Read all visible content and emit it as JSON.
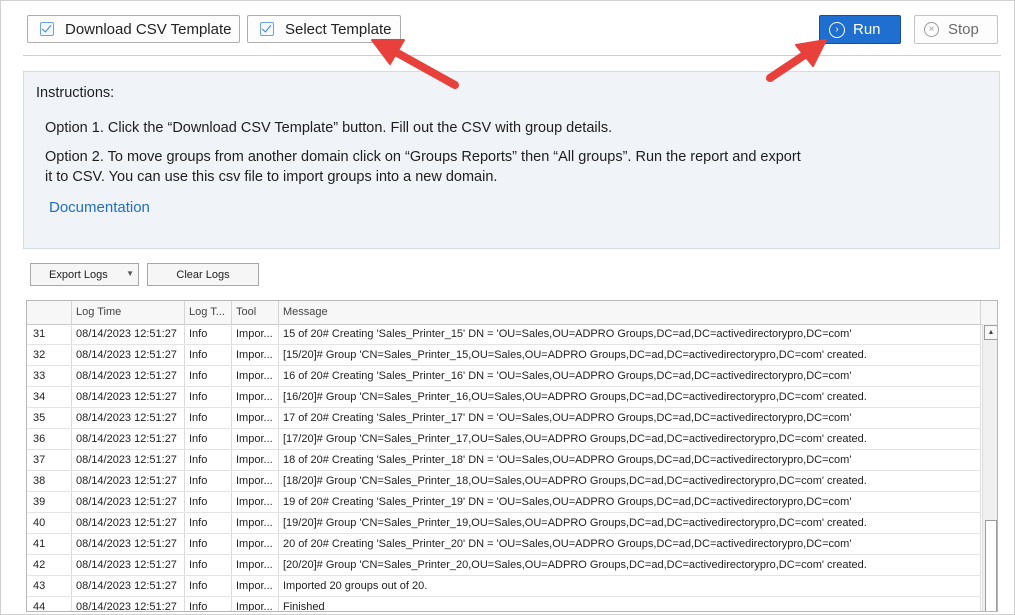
{
  "toolbar": {
    "download_label": "Download CSV Template",
    "select_label": "Select Template",
    "run_label": "Run",
    "stop_label": "Stop"
  },
  "instructions": {
    "title": "Instructions:",
    "option1": "Option 1. Click the “Download CSV Template” button. Fill out the CSV with group details.",
    "option2": "Option 2. To move groups from another domain click on “Groups Reports” then “All groups”. Run the report and export it to CSV. You can use this csv file to import groups into a new domain.",
    "doc_link": "Documentation"
  },
  "logs": {
    "export_label": "Export Logs",
    "clear_label": "Clear Logs",
    "columns": [
      "",
      "Log Time",
      "Log T...",
      "Tool",
      "Message"
    ],
    "rows": [
      [
        "31",
        "08/14/2023 12:51:27",
        "Info",
        "Impor...",
        "15 of 20# Creating 'Sales_Printer_15' DN = 'OU=Sales,OU=ADPRO Groups,DC=ad,DC=activedirectorypro,DC=com'"
      ],
      [
        "32",
        "08/14/2023 12:51:27",
        "Info",
        "Impor...",
        "[15/20]# Group 'CN=Sales_Printer_15,OU=Sales,OU=ADPRO Groups,DC=ad,DC=activedirectorypro,DC=com' created."
      ],
      [
        "33",
        "08/14/2023 12:51:27",
        "Info",
        "Impor...",
        "16 of 20# Creating 'Sales_Printer_16' DN = 'OU=Sales,OU=ADPRO Groups,DC=ad,DC=activedirectorypro,DC=com'"
      ],
      [
        "34",
        "08/14/2023 12:51:27",
        "Info",
        "Impor...",
        "[16/20]# Group 'CN=Sales_Printer_16,OU=Sales,OU=ADPRO Groups,DC=ad,DC=activedirectorypro,DC=com' created."
      ],
      [
        "35",
        "08/14/2023 12:51:27",
        "Info",
        "Impor...",
        "17 of 20# Creating 'Sales_Printer_17' DN = 'OU=Sales,OU=ADPRO Groups,DC=ad,DC=activedirectorypro,DC=com'"
      ],
      [
        "36",
        "08/14/2023 12:51:27",
        "Info",
        "Impor...",
        "[17/20]# Group 'CN=Sales_Printer_17,OU=Sales,OU=ADPRO Groups,DC=ad,DC=activedirectorypro,DC=com' created."
      ],
      [
        "37",
        "08/14/2023 12:51:27",
        "Info",
        "Impor...",
        "18 of 20# Creating 'Sales_Printer_18' DN = 'OU=Sales,OU=ADPRO Groups,DC=ad,DC=activedirectorypro,DC=com'"
      ],
      [
        "38",
        "08/14/2023 12:51:27",
        "Info",
        "Impor...",
        "[18/20]# Group 'CN=Sales_Printer_18,OU=Sales,OU=ADPRO Groups,DC=ad,DC=activedirectorypro,DC=com' created."
      ],
      [
        "39",
        "08/14/2023 12:51:27",
        "Info",
        "Impor...",
        "19 of 20# Creating 'Sales_Printer_19' DN = 'OU=Sales,OU=ADPRO Groups,DC=ad,DC=activedirectorypro,DC=com'"
      ],
      [
        "40",
        "08/14/2023 12:51:27",
        "Info",
        "Impor...",
        "[19/20]# Group 'CN=Sales_Printer_19,OU=Sales,OU=ADPRO Groups,DC=ad,DC=activedirectorypro,DC=com' created."
      ],
      [
        "41",
        "08/14/2023 12:51:27",
        "Info",
        "Impor...",
        "20 of 20# Creating 'Sales_Printer_20' DN = 'OU=Sales,OU=ADPRO Groups,DC=ad,DC=activedirectorypro,DC=com'"
      ],
      [
        "42",
        "08/14/2023 12:51:27",
        "Info",
        "Impor...",
        "[20/20]# Group 'CN=Sales_Printer_20,OU=Sales,OU=ADPRO Groups,DC=ad,DC=activedirectorypro,DC=com' created."
      ],
      [
        "43",
        "08/14/2023 12:51:27",
        "Info",
        "Impor...",
        "Imported 20 groups out of 20."
      ],
      [
        "44",
        "08/14/2023 12:51:27",
        "Info",
        "Impor...",
        "Finished"
      ]
    ]
  },
  "colors": {
    "run_button": "#1f6fd1",
    "annotation_arrow": "#e8413c",
    "link": "#1f6fc5"
  },
  "icons": {
    "checkbox": "check-icon",
    "run": "play-circle-icon",
    "stop": "close-circle-icon"
  }
}
